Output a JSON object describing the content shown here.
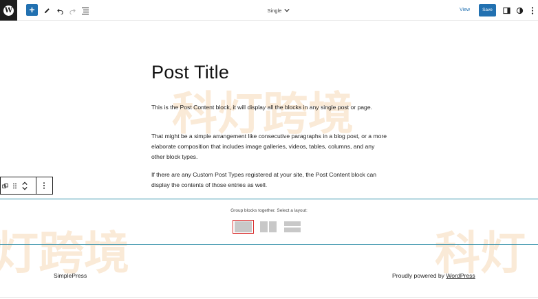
{
  "topbar": {
    "logo_glyph": "W",
    "add_label": "+",
    "doc_title": "Single",
    "view_label": "View",
    "save_label": "Save"
  },
  "post": {
    "title": "Post Title",
    "paragraphs": [
      "This is the Post Content block, it will display all the blocks in any single post or page.",
      "That might be a simple arrangement like consecutive paragraphs in a blog post, or a more elaborate composition that includes image galleries, videos, tables, columns, and any other block types.",
      "If there are any Custom Post Types registered at your site, the Post Content block can display the contents of those entries as well."
    ]
  },
  "group_block": {
    "label": "Group blocks together. Select a layout:"
  },
  "footer": {
    "site_name": "SimplePress",
    "credit_prefix": "Proudly powered by ",
    "credit_link": "WordPress"
  },
  "watermark": {
    "text_full": "科灯跨境",
    "text_left": "灯跨境",
    "text_right": "科灯"
  },
  "colors": {
    "accent": "#2271b1",
    "group_border": "#2f8ea8",
    "selected_outline": "#d93030"
  }
}
